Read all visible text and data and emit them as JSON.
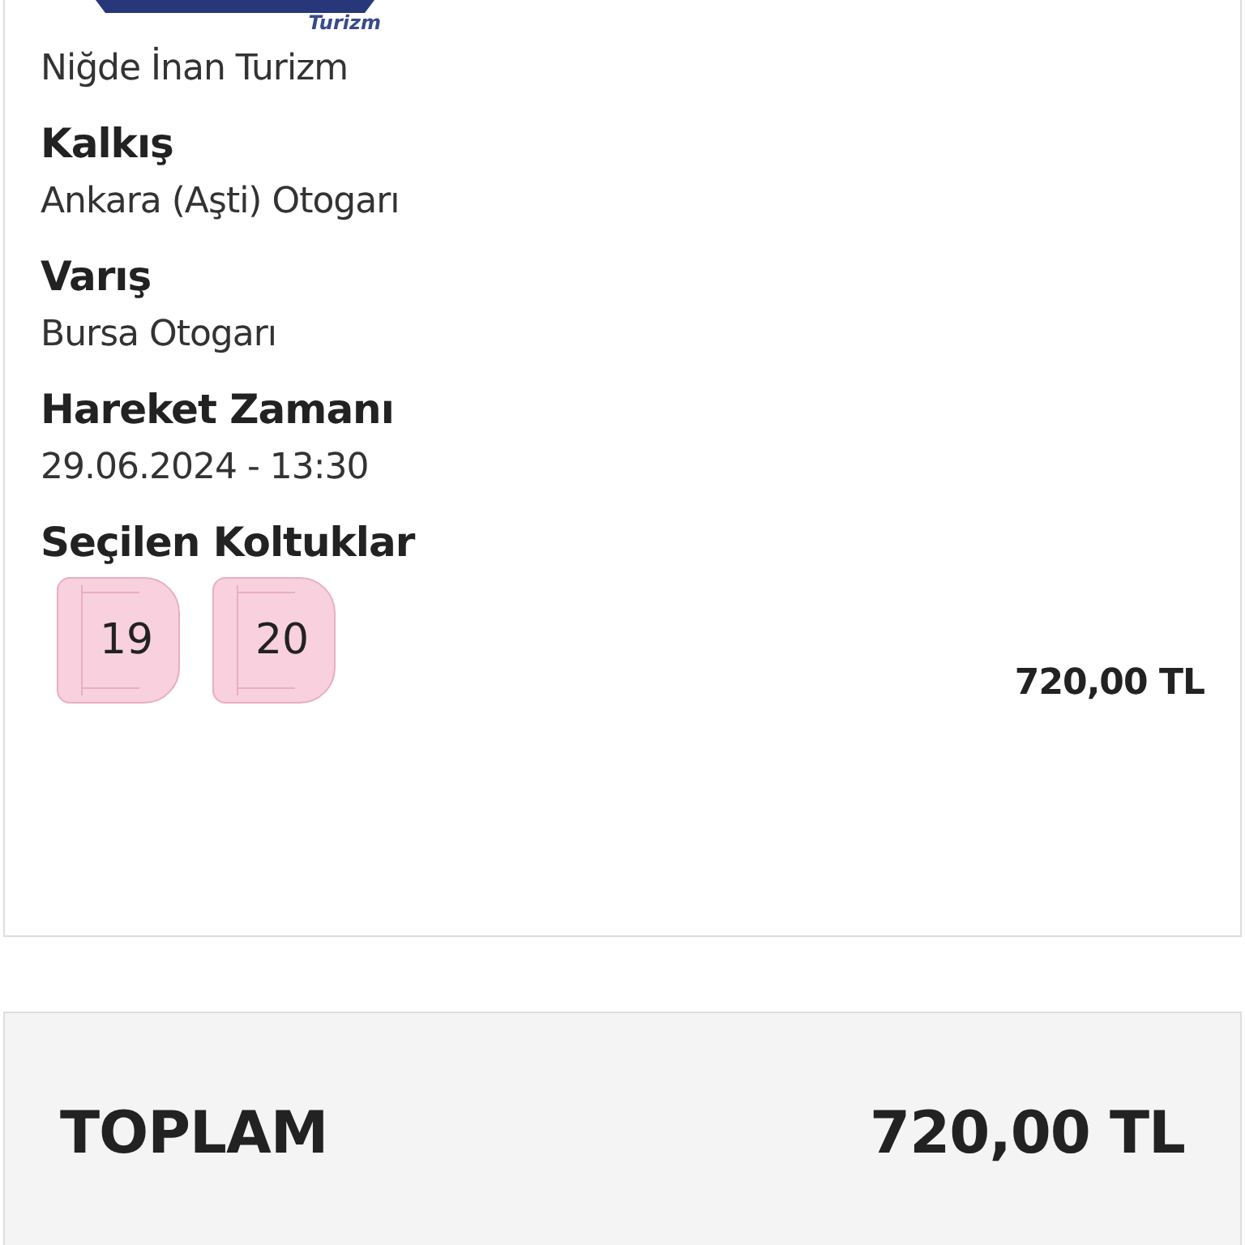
{
  "company": {
    "logo_text": "Turizm",
    "name": "Niğde İnan Turizm"
  },
  "fields": [
    {
      "label": "Kalkış",
      "value": "Ankara (Aşti) Otogarı"
    },
    {
      "label": "Varış",
      "value": "Bursa Otogarı"
    },
    {
      "label": "Hareket Zamanı",
      "value": "29.06.2024 - 13:30"
    }
  ],
  "seats": {
    "label": "Seçilen Koltuklar",
    "items": [
      "19",
      "20"
    ]
  },
  "price": "720,00 TL",
  "total": {
    "label": "TOPLAM",
    "amount": "720,00 TL"
  }
}
